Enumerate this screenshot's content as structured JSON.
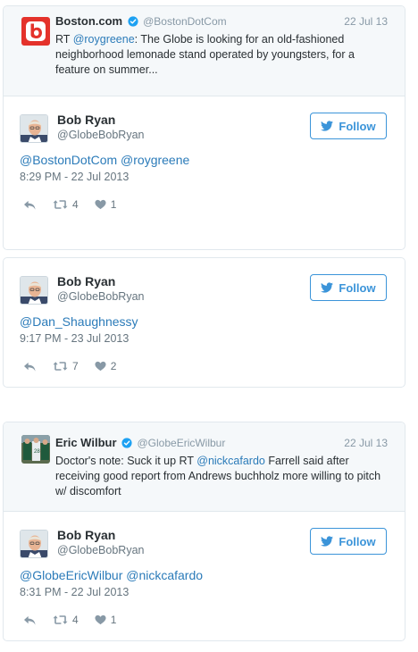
{
  "cards": [
    {
      "quoted": {
        "name": "Boston.com",
        "handle": "@BostonDotCom",
        "date": "22 Jul 13",
        "text_prefix": "RT ",
        "text_link": "@roygreene",
        "text_rest": ": The Globe is looking for an old-fashioned neighborhood lemonade stand operated by youngsters, for a feature on summer..."
      },
      "author": {
        "name": "Bob Ryan",
        "handle": "@GlobeBobRyan"
      },
      "follow_label": "Follow",
      "body": "@BostonDotCom @roygreene",
      "time": "8:29 PM - 22 Jul 2013",
      "retweets": "4",
      "likes": "1"
    },
    {
      "author": {
        "name": "Bob Ryan",
        "handle": "@GlobeBobRyan"
      },
      "follow_label": "Follow",
      "body": "@Dan_Shaughnessy",
      "time": "9:17 PM - 23 Jul 2013",
      "retweets": "7",
      "likes": "2"
    },
    {
      "quoted": {
        "name": "Eric Wilbur",
        "handle": "@GlobeEricWilbur",
        "date": "22 Jul 13",
        "text_prefix": "Doctor's note: Suck it up RT ",
        "text_link": "@nickcafardo",
        "text_rest": " Farrell said after receiving good report from Andrews buchholz more willing to pitch w/ discomfort"
      },
      "author": {
        "name": "Bob Ryan",
        "handle": "@GlobeBobRyan"
      },
      "follow_label": "Follow",
      "body": "@GlobeEricWilbur @nickcafardo",
      "time": "8:31 PM - 22 Jul 2013",
      "retweets": "4",
      "likes": "1"
    }
  ],
  "colors": {
    "link": "#2b7bb9",
    "follow": "#3b94d9",
    "verified": "#1da1f2",
    "boston_logo": "#e4322b"
  }
}
